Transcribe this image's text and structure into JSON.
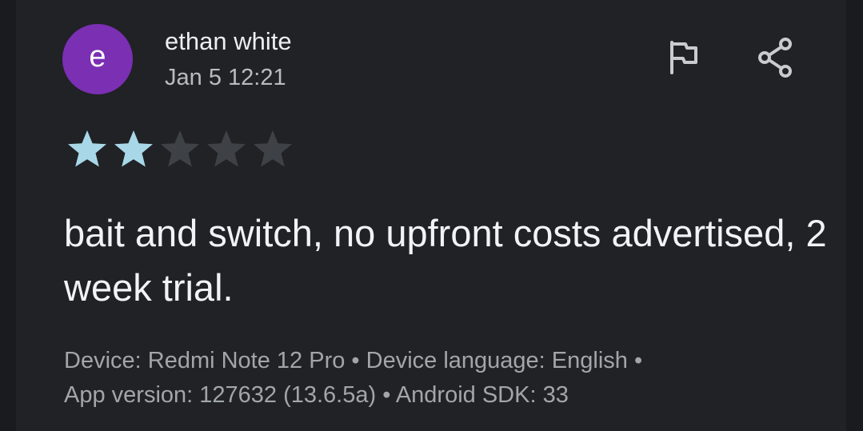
{
  "review": {
    "avatar_letter": "e",
    "avatar_color": "#7b2fb3",
    "author": "ethan white",
    "date": "Jan 5 12:21",
    "rating": 2,
    "max_rating": 5,
    "star_filled_color": "#a8d8e8",
    "star_empty_color": "#3e4246",
    "text": "bait and switch, no upfront costs advertised, 2 week trial.",
    "meta_line1": "Device: Redmi Note 12 Pro • Device language: English •",
    "meta_line2": "App version: 127632 (13.6.5a) • Android SDK: 33"
  },
  "actions": {
    "flag_icon": "flag-icon",
    "share_icon": "share-icon"
  }
}
